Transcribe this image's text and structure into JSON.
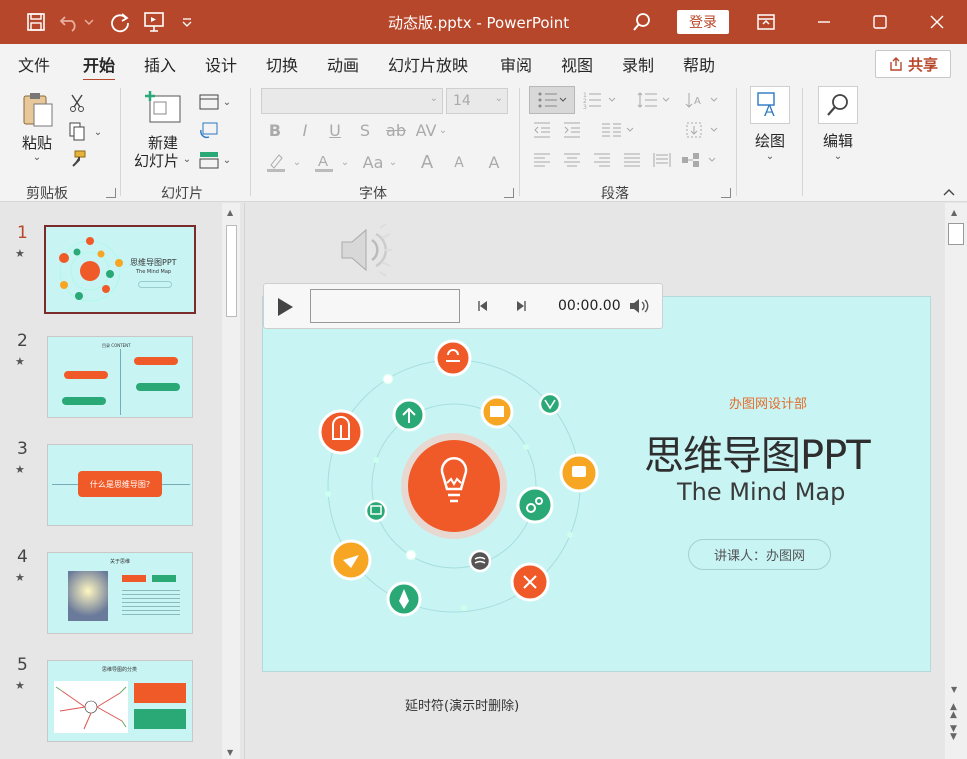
{
  "title_bar": {
    "title": "动态版.pptx  -  PowerPoint",
    "login_label": "登录",
    "icons": [
      "save-icon",
      "undo-icon",
      "redo-icon",
      "present-icon",
      "customize-icon",
      "search-icon",
      "ribbon-display-icon",
      "minimize-icon",
      "maximize-icon",
      "close-icon"
    ]
  },
  "menu": {
    "tabs": [
      "文件",
      "开始",
      "插入",
      "设计",
      "切换",
      "动画",
      "幻灯片放映",
      "审阅",
      "视图",
      "录制",
      "帮助"
    ],
    "active_tab": "开始",
    "share_label": "共享"
  },
  "ribbon": {
    "groups": {
      "clipboard": "剪贴板",
      "slides": "幻灯片",
      "font": "字体",
      "paragraph": "段落"
    },
    "paste_label": "粘贴",
    "new_slide_label_1": "新建",
    "new_slide_label_2": "幻灯片",
    "font_size_value": "14",
    "drawing_label": "绘图",
    "editing_label": "编辑",
    "font_buttons": [
      "B",
      "I",
      "U",
      "S",
      "ab",
      "AV",
      "A",
      "Aa",
      "A",
      "A",
      "A"
    ]
  },
  "thumbnails": [
    {
      "num": "1",
      "title": "思维导图PPT",
      "sub": "The Mind Map",
      "active": true
    },
    {
      "num": "2",
      "title": "目录 CONTENT",
      "active": false
    },
    {
      "num": "3",
      "title": "什么是思维导图?",
      "active": false
    },
    {
      "num": "4",
      "title": "关于思维",
      "active": false
    },
    {
      "num": "5",
      "title": "思维导图的分类",
      "active": false
    }
  ],
  "player": {
    "time": "00:00.00"
  },
  "slide": {
    "dept": "办图网设计部",
    "title": "思维导图PPT",
    "subtitle": "The Mind Map",
    "speaker": "讲课人：办图网"
  },
  "notes": "延时符(演示时删除)",
  "colors": {
    "brand": "#b7472a",
    "slide_bg": "#c9f4f4",
    "orange": "#f05a28",
    "green": "#2aa876",
    "amber": "#f6a623"
  }
}
